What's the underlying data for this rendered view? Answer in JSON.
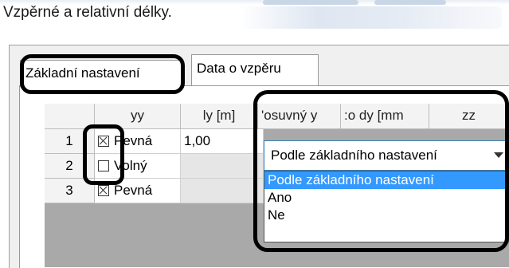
{
  "window": {
    "heading": "Vzpěrné a relativní délky."
  },
  "tabs": [
    {
      "label": "Základní nastavení"
    },
    {
      "label": "Data o vzpěru"
    }
  ],
  "grid": {
    "columns": [
      "yy",
      "ly [m]",
      "'osuvný y",
      ":o dy [mm",
      "zz"
    ],
    "rows": [
      {
        "num": "1",
        "checked": true,
        "state": "Pevná",
        "ly": "1,00"
      },
      {
        "num": "2",
        "checked": false,
        "state": "Volný",
        "ly": ""
      },
      {
        "num": "3",
        "checked": true,
        "state": "Pevná",
        "ly": ""
      }
    ]
  },
  "combo": {
    "value": "Podle základního nastavení",
    "options": [
      "Podle základního nastavení",
      "Ano",
      "Ne"
    ],
    "selected_index": 0
  },
  "colors": {
    "selection": "#3399ff",
    "combo_border": "#3c7fb1",
    "annotation": "#000000"
  }
}
